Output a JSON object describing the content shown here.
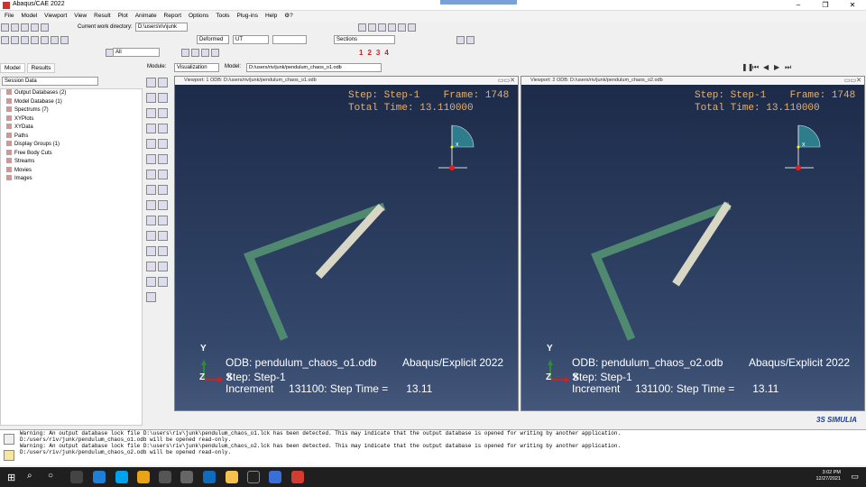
{
  "window": {
    "title": "Abaqus/CAE 2022"
  },
  "menu": [
    "File",
    "Model",
    "Viewport",
    "View",
    "Result",
    "Plot",
    "Animate",
    "Report",
    "Options",
    "Tools",
    "Plug-ins",
    "Help",
    "⚙?"
  ],
  "toolbar": {
    "cwd_label": "Current work directory:",
    "cwd_value": "D:\\users\\riv\\junk",
    "deformed": "Deformed",
    "ut": "UT",
    "sections": "Sections",
    "all": "All",
    "numbers": [
      "1",
      "2",
      "3",
      "4"
    ]
  },
  "context": {
    "module_label": "Module:",
    "module_value": "Visualization",
    "model_label": "Model:",
    "model_value": "D:/users/riv/junk/pendulum_chaos_o1.odb"
  },
  "left": {
    "tabs": [
      "Model",
      "Results"
    ],
    "session": "Session Data",
    "tree": [
      "Output Databases (2)",
      "Model Database (1)",
      "Spectrums (7)",
      "XYPlots",
      "XYData",
      "Paths",
      "Display Groups (1)",
      "Free Body Cuts",
      "Streams",
      "Movies",
      "Images"
    ]
  },
  "viewports": [
    {
      "title": "Viewport: 1   ODB: D:/users/riv/junk/pendulum_chaos_o1.odb",
      "step": "Step: Step-1    Frame: 1748",
      "total": "Total Time: 13.110000",
      "odb": "ODB: pendulum_chaos_o1.odb",
      "solver": "Abaqus/Explicit 2022",
      "stepline": "Step: Step-1",
      "increment": "Increment     131100: Step Time =      13.11",
      "axis_y": "Y",
      "axis_z": "Z",
      "axis_x": "X",
      "triad_x": "x"
    },
    {
      "title": "Viewport: 2   ODB: D:/users/riv/junk/pendulum_chaos_o2.odb",
      "step": "Step: Step-1    Frame: 1748",
      "total": "Total Time: 13.110000",
      "odb": "ODB: pendulum_chaos_o2.odb",
      "solver": "Abaqus/Explicit 2022",
      "stepline": "Step: Step-1",
      "increment": "Increment     131100: Step Time =      13.11",
      "axis_y": "Y",
      "axis_z": "Z",
      "axis_x": "X",
      "triad_x": "x"
    }
  ],
  "messages": [
    "Warning: An output database lock file D:\\users\\riv\\junk\\pendulum_chaos_o1.lck has been detected. This may indicate that the output database is opened for writing by another application.",
    "D:/users/riv/junk/pendulum_chaos_o1.odb will be opened read-only.",
    "Warning: An output database lock file D:\\users\\riv\\junk\\pendulum_chaos_o2.lck has been detected. This may indicate that the output database is opened for writing by another application.",
    "D:/users/riv/junk/pendulum_chaos_o2.odb will be opened read-only."
  ],
  "brand": "3S SIMULIA",
  "clock": {
    "time": "3:02 PM",
    "date": "12/27/2021"
  },
  "colors": {
    "arm1": "#4f8a70",
    "arm2": "#d8d6c4",
    "triad": "#2e7d8c"
  }
}
